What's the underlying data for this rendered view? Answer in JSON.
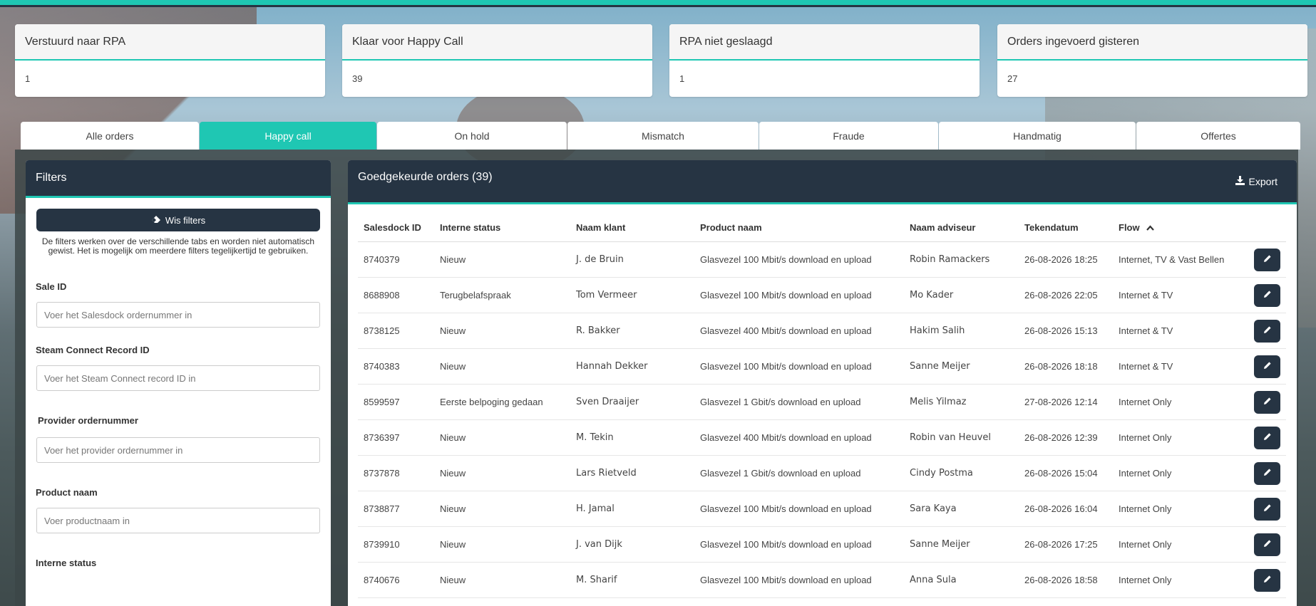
{
  "stat_cards": [
    {
      "title": "Verstuurd naar RPA",
      "value": "1"
    },
    {
      "title": "Klaar voor Happy Call",
      "value": "39"
    },
    {
      "title": "RPA niet geslaagd",
      "value": "1"
    },
    {
      "title": "Orders ingevoerd gisteren",
      "value": "27"
    }
  ],
  "tabs": [
    {
      "label": "Alle orders",
      "active": false
    },
    {
      "label": "Happy call",
      "active": true
    },
    {
      "label": "On hold",
      "active": false
    },
    {
      "label": "Mismatch",
      "active": false
    },
    {
      "label": "Fraude",
      "active": false
    },
    {
      "label": "Handmatig",
      "active": false
    },
    {
      "label": "Offertes",
      "active": false
    }
  ],
  "filters": {
    "title": "Filters",
    "clear_label": "Wis filters",
    "note": "De filters werken over de verschillende tabs en worden niet automatisch gewist. Het is mogelijk om meerdere filters tegelijkertijd te gebruiken.",
    "fields": [
      {
        "label": "Sale ID",
        "placeholder": "Voer het Salesdock ordernummer in"
      },
      {
        "label": "Steam Connect Record ID",
        "placeholder": "Voer het Steam Connect record ID in"
      },
      {
        "label": "Provider ordernummer",
        "placeholder": "Voer het provider ordernummer in"
      },
      {
        "label": "Product naam",
        "placeholder": "Voer productnaam in"
      }
    ],
    "next_label": "Interne status"
  },
  "orders": {
    "title": "Goedgekeurde orders (39)",
    "export_label": "Export",
    "columns": [
      "Salesdock ID",
      "Interne status",
      "Naam klant",
      "Product naam",
      "Naam adviseur",
      "Tekendatum",
      "Flow"
    ],
    "sort_column": "Flow",
    "sort_direction": "ascending",
    "rows": [
      [
        "8740379",
        "Nieuw",
        "J. de Bruin",
        "Glasvezel 100 Mbit/s download en upload",
        "Robin Ramackers",
        "26-08-2026 18:25",
        "Internet, TV & Vast Bellen"
      ],
      [
        "8688908",
        "Terugbelafspraak",
        "Tom Vermeer",
        "Glasvezel 100 Mbit/s download en upload",
        "Mo Kader",
        "26-08-2026 22:05",
        "Internet & TV"
      ],
      [
        "8738125",
        "Nieuw",
        "R. Bakker",
        "Glasvezel 400 Mbit/s download en upload",
        "Hakim Salih",
        "26-08-2026 15:13",
        "Internet & TV"
      ],
      [
        "8740383",
        "Nieuw",
        "Hannah Dekker",
        "Glasvezel 100 Mbit/s download en upload",
        "Sanne Meijer",
        "26-08-2026 18:18",
        "Internet & TV"
      ],
      [
        "8599597",
        "Eerste belpoging gedaan",
        "Sven Draaijer",
        "Glasvezel 1 Gbit/s download en upload",
        "Melis Yilmaz",
        "27-08-2026 12:14",
        "Internet Only"
      ],
      [
        "8736397",
        "Nieuw",
        "M. Tekin",
        "Glasvezel 400 Mbit/s download en upload",
        "Robin van Heuvel",
        "26-08-2026 12:39",
        "Internet Only"
      ],
      [
        "8737878",
        "Nieuw",
        "Lars Rietveld",
        "Glasvezel 1 Gbit/s download en upload",
        "Cindy Postma",
        "26-08-2026 15:04",
        "Internet Only"
      ],
      [
        "8738877",
        "Nieuw",
        "H. Jamal",
        "Glasvezel 100 Mbit/s download en upload",
        "Sara Kaya",
        "26-08-2026 16:04",
        "Internet Only"
      ],
      [
        "8739910",
        "Nieuw",
        "J. van Dijk",
        "Glasvezel 100 Mbit/s download en upload",
        "Sanne Meijer",
        "26-08-2026 17:25",
        "Internet Only"
      ],
      [
        "8740676",
        "Nieuw",
        "M. Sharif",
        "Glasvezel 100 Mbit/s download en upload",
        "Anna Sula",
        "26-08-2026 18:58",
        "Internet Only"
      ]
    ]
  },
  "colors": {
    "accent": "#1fc7b3",
    "dark": "#263443"
  },
  "icons": {
    "clear": "eraser-icon",
    "export": "download-icon",
    "sort": "chevron-up-icon",
    "edit": "pencil-icon"
  }
}
